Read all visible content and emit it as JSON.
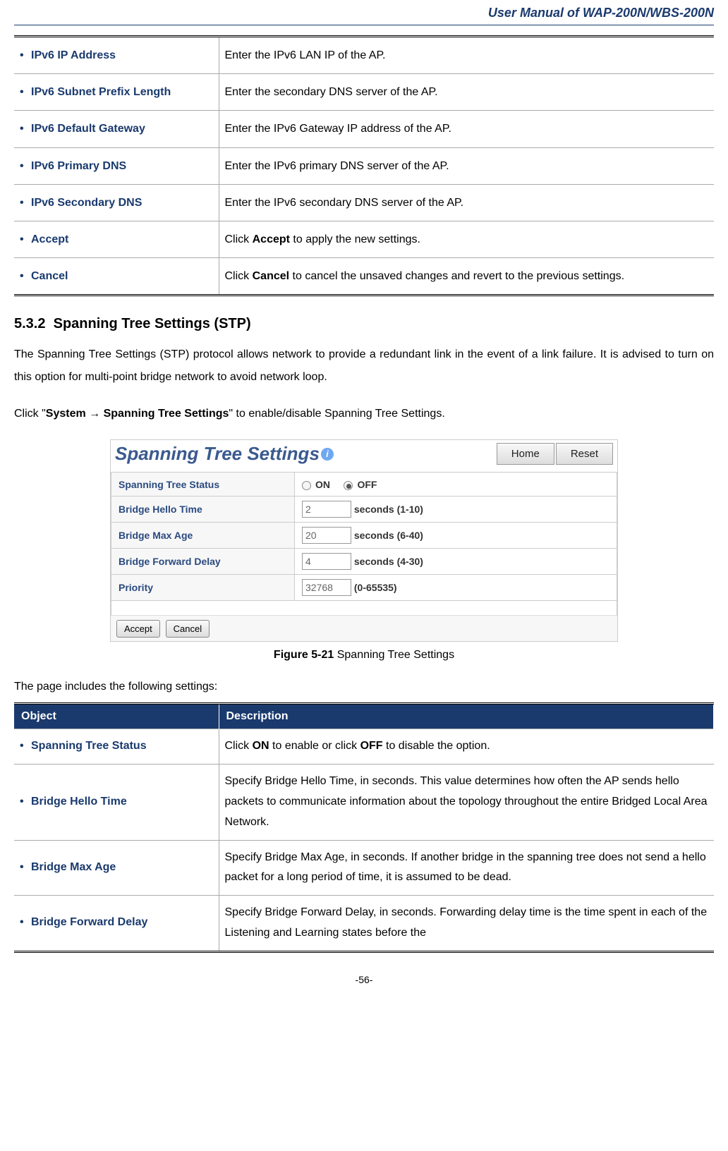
{
  "header": {
    "title": "User Manual of WAP-200N/WBS-200N"
  },
  "table1": {
    "rows": [
      {
        "label": "IPv6 IP Address",
        "desc": "Enter the IPv6 LAN IP of the AP."
      },
      {
        "label": "IPv6 Subnet Prefix Length",
        "desc": "Enter the secondary DNS server of the AP."
      },
      {
        "label": "IPv6 Default Gateway",
        "desc": "Enter the IPv6 Gateway IP address of the AP."
      },
      {
        "label": "IPv6 Primary DNS",
        "desc": "Enter the IPv6 primary DNS server of the AP."
      },
      {
        "label": "IPv6 Secondary DNS",
        "desc": "Enter the IPv6 secondary DNS server of the AP."
      }
    ],
    "accept": {
      "label": "Accept",
      "pre": "Click ",
      "bold": "Accept",
      "post": " to apply the new settings."
    },
    "cancel": {
      "label": "Cancel",
      "pre": "Click ",
      "bold": "Cancel",
      "post": " to cancel the unsaved changes and revert to the previous settings."
    }
  },
  "section": {
    "num": "5.3.2",
    "title": "Spanning Tree Settings (STP)",
    "para1": "The Spanning Tree Settings (STP) protocol allows network to provide a redundant link in the event of a link failure. It is advised to turn on this option for multi-point bridge network to avoid network loop.",
    "para2_pre": "Click \"",
    "para2_bold": "System → Spanning Tree Settings",
    "para2_post": "\" to enable/disable Spanning Tree Settings."
  },
  "stp": {
    "title": "Spanning Tree Settings",
    "home": "Home",
    "reset": "Reset",
    "rows": {
      "status_label": "Spanning Tree Status",
      "on": "ON",
      "off": "OFF",
      "hello_label": "Bridge Hello Time",
      "hello_val": "2",
      "hello_unit": "seconds (1-10)",
      "maxage_label": "Bridge Max Age",
      "maxage_val": "20",
      "maxage_unit": "seconds (6-40)",
      "fwd_label": "Bridge Forward Delay",
      "fwd_val": "4",
      "fwd_unit": "seconds (4-30)",
      "prio_label": "Priority",
      "prio_val": "32768",
      "prio_unit": "(0-65535)"
    },
    "accept_btn": "Accept",
    "cancel_btn": "Cancel"
  },
  "figure": {
    "bold": "Figure 5-21",
    "rest": " Spanning Tree Settings"
  },
  "pre_table2": "The page includes the following settings:",
  "table2": {
    "h1": "Object",
    "h2": "Description",
    "r1": {
      "label": "Spanning Tree Status",
      "pre": "Click ",
      "b1": "ON",
      "mid": " to enable or click ",
      "b2": "OFF",
      "post": " to disable the option."
    },
    "r2": {
      "label": "Bridge Hello Time",
      "desc": "Specify Bridge Hello Time, in seconds. This value determines how often the AP sends hello packets to communicate information about the topology throughout the entire Bridged Local Area Network."
    },
    "r3": {
      "label": "Bridge Max Age",
      "desc": "Specify Bridge Max Age, in seconds. If another bridge in the spanning tree does not send a hello packet for a long period of time, it is assumed to be dead."
    },
    "r4": {
      "label": "Bridge Forward Delay",
      "desc": "Specify Bridge Forward Delay, in seconds. Forwarding delay time is the time spent in each of the Listening and Learning states before the"
    }
  },
  "page_num": "-56-"
}
